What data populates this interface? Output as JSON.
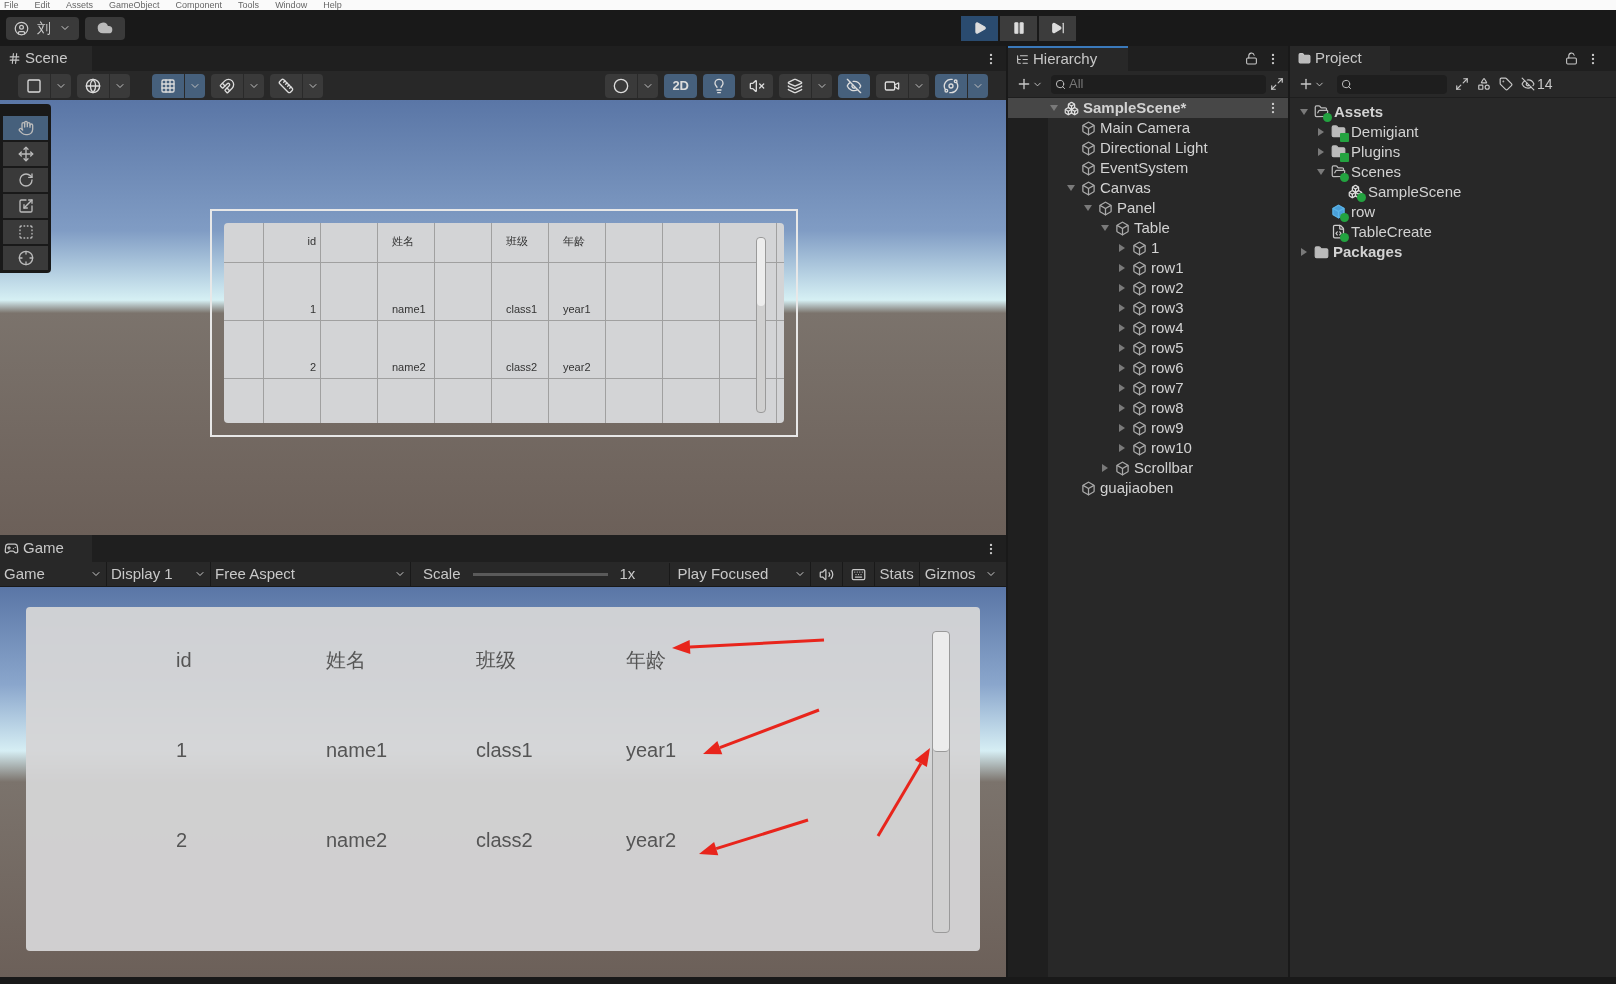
{
  "menu_bar": [
    "File",
    "Edit",
    "Assets",
    "GameObject",
    "Component",
    "Tools",
    "Window",
    "Help"
  ],
  "toolbar": {
    "account": "刘",
    "play_buttons": [
      {
        "kind": "play",
        "on": true
      },
      {
        "kind": "pause",
        "on": false
      },
      {
        "kind": "step",
        "on": false
      }
    ]
  },
  "scene": {
    "tab": "Scene",
    "toolbar_left": [
      {
        "kind": "handle",
        "on": false,
        "dropdown": true
      },
      {
        "kind": "global",
        "on": false,
        "dropdown": true
      },
      {
        "kind": "gridsnap",
        "on": true,
        "dropdown": true
      },
      {
        "kind": "increment",
        "on": false,
        "dropdown": true
      },
      {
        "kind": "grid",
        "on": false,
        "dropdown": true
      }
    ],
    "toolbar_right": [
      {
        "kind": "shading",
        "on": false,
        "dropdown": true
      },
      {
        "kind": "dimension",
        "label": "2D",
        "on": true,
        "dropdown": false
      },
      {
        "kind": "lighting",
        "on": true,
        "dropdown": false
      },
      {
        "kind": "audio",
        "on": false,
        "dropdown": false
      },
      {
        "kind": "effects",
        "on": false,
        "dropdown": true
      },
      {
        "kind": "hidden",
        "on": true,
        "dropdown": false
      },
      {
        "kind": "camera",
        "on": false,
        "dropdown": true
      },
      {
        "kind": "gizmos",
        "on": true,
        "dropdown": true
      }
    ],
    "tools": [
      {
        "kind": "hand",
        "selected": true
      },
      {
        "kind": "move",
        "selected": false
      },
      {
        "kind": "rotate",
        "selected": false
      },
      {
        "kind": "scale",
        "selected": false
      },
      {
        "kind": "rect",
        "selected": false
      },
      {
        "kind": "transform",
        "selected": false
      }
    ],
    "table": {
      "columns": [
        "id",
        "姓名",
        "班级",
        "年龄"
      ],
      "rows": [
        [
          "1",
          "name1",
          "class1",
          "year1"
        ],
        [
          "2",
          "name2",
          "class2",
          "year2"
        ]
      ]
    }
  },
  "game": {
    "tab": "Game",
    "toolbar": {
      "mode": "Game",
      "display": "Display 1",
      "aspect": "Free Aspect",
      "scale_label": "Scale",
      "scale_value": "1x",
      "play_mode": "Play Focused",
      "stats": "Stats",
      "gizmos": "Gizmos"
    },
    "table": {
      "columns": [
        "id",
        "姓名",
        "班级",
        "年龄"
      ],
      "rows": [
        [
          "1",
          "name1",
          "class1",
          "year1"
        ],
        [
          "2",
          "name2",
          "class2",
          "year2"
        ]
      ]
    }
  },
  "hierarchy": {
    "tab": "Hierarchy",
    "search": {
      "placeholder": "All"
    },
    "items": [
      {
        "label": "SampleScene*",
        "expanded": true,
        "selected": true,
        "children": [
          {
            "label": "Main Camera",
            "selected": false
          },
          {
            "label": "Directional Light",
            "selected": false
          },
          {
            "label": "EventSystem",
            "selected": false
          },
          {
            "label": "Canvas",
            "expanded": true,
            "selected": false,
            "children": [
              {
                "label": "Panel",
                "expanded": true,
                "selected": false,
                "children": [
                  {
                    "label": "Table",
                    "expanded": true,
                    "selected": false,
                    "children": [
                      {
                        "label": "1",
                        "expanded": false,
                        "selected": false
                      },
                      {
                        "label": "row1",
                        "expanded": false,
                        "selected": false
                      },
                      {
                        "label": "row2",
                        "expanded": false,
                        "selected": false
                      },
                      {
                        "label": "row3",
                        "expanded": false,
                        "selected": false
                      },
                      {
                        "label": "row4",
                        "expanded": false,
                        "selected": false
                      },
                      {
                        "label": "row5",
                        "expanded": false,
                        "selected": false
                      },
                      {
                        "label": "row6",
                        "expanded": false,
                        "selected": false
                      },
                      {
                        "label": "row7",
                        "expanded": false,
                        "selected": false
                      },
                      {
                        "label": "row8",
                        "expanded": false,
                        "selected": false
                      },
                      {
                        "label": "row9",
                        "expanded": false,
                        "selected": false
                      },
                      {
                        "label": "row10",
                        "expanded": false,
                        "selected": false
                      }
                    ]
                  },
                  {
                    "label": "Scrollbar",
                    "expanded": false,
                    "selected": false
                  }
                ]
              }
            ]
          },
          {
            "label": "guajiaoben",
            "selected": false
          }
        ]
      }
    ]
  },
  "project": {
    "tab": "Project",
    "hidden_count": "14",
    "items": [
      {
        "label": "Assets",
        "kind": "newfolder",
        "expanded": true,
        "bold": true,
        "children": [
          {
            "label": "Demigiant",
            "kind": "editfolder",
            "expanded": false,
            "bold": false
          },
          {
            "label": "Plugins",
            "kind": "editfolder",
            "expanded": false,
            "bold": false
          },
          {
            "label": "Scenes",
            "kind": "newfolder",
            "expanded": true,
            "bold": false,
            "children": [
              {
                "label": "SampleScene",
                "kind": "scene",
                "bold": false
              }
            ]
          },
          {
            "label": "row",
            "kind": "prefab",
            "bold": false
          },
          {
            "label": "TableCreate",
            "kind": "script",
            "bold": false
          }
        ]
      },
      {
        "label": "Packages",
        "kind": "folder",
        "expanded": false,
        "bold": true
      }
    ]
  }
}
